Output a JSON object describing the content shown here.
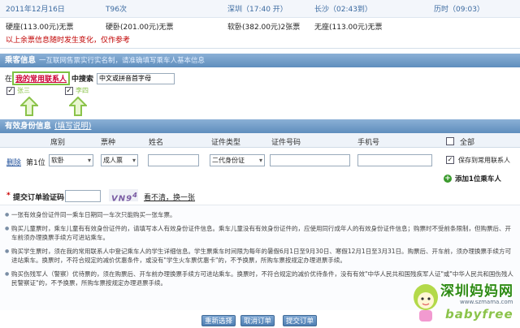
{
  "trip": {
    "date": "2011年12月16日",
    "train": "T96次",
    "from_station": "深圳（17:40 开）",
    "to_station": "长沙（02:43到）",
    "duration": "历时（09:03）",
    "seats": [
      "硬座(113.00元)无票",
      "硬卧(201.00元)无票",
      "软卧(382.00元)2张票",
      "无座(113.00元)无票"
    ],
    "warning": "以上余票信息随时发生变化，仅作参考"
  },
  "passenger_section": {
    "title": "乘客信息",
    "note": "一互联网售票实行实名制，请准确填写乘车人基本信息",
    "prefix": "在",
    "highlight_link": "我的常用联系人",
    "search_label": "中搜索",
    "search_placeholder": "中文或拼音首字母",
    "passengers": [
      "张三",
      "李四"
    ]
  },
  "id_section": {
    "title": "有效身份信息",
    "help_link": "(填写说明)"
  },
  "table": {
    "headers": [
      "席别",
      "票种",
      "姓名",
      "证件类型",
      "证件号码",
      "手机号"
    ],
    "select_all": "全部",
    "row": {
      "delete": "删除",
      "position": "第1位",
      "seat": "软卧",
      "ticket_type": "成人票",
      "id_type": "二代身份证",
      "save_contact": "保存到常用联系人"
    },
    "add_passenger": "添加1位乘车人"
  },
  "captcha": {
    "label": "提交订单验证码:",
    "code": "VN9",
    "code_sup": "4",
    "refresh": "看不清，换一张"
  },
  "notes": [
    "一张有效身份证件同一乘车日期同一车次只能购买一张车票。",
    "购买儿童票时，乘车儿童有有效身份证件的，请填写本人有效身份证件信息。乘车儿童没有有效身份证件的，应使用同行成年人的有效身份证件信息；购票时不受前条限制，但购票后、开车前须办理换票手续方可进站乘车。",
    "购买学生票时，须在我的常用联系人中登记乘车人的学生详细信息。学生票乘车时间限为每年的暑假6月1日至9月30日、寒假12月1日至3月31日。购票后、开车前，须办理换票手续方可进站乘车。换票时，不符合规定的减价优惠条件，或没有\"学生火车票优惠卡\"的，不予换票，所购车票按规定办理退票手续。",
    "购买伤残军人（警察）优待票的，须在购票后、开车前办理换票手续方可进站乘车。换票时，不符合规定的减价优待条件，没有有效\"中华人民共和国残疾军人证\"或\"中华人民共和国伤残人民警察证\"的，不予换票，所购车票按规定办理退票手续。"
  ],
  "buttons": {
    "reselect": "重新选择",
    "cancel": "取消订单",
    "submit": "提交订单"
  },
  "watermark": {
    "title": "深圳妈妈网",
    "url": "www.szmama.com",
    "brand": "babyfree"
  },
  "colors": {
    "header_blue": "#5f8ebd",
    "warning_red": "#c00000",
    "highlight_green": "#7dc242"
  }
}
